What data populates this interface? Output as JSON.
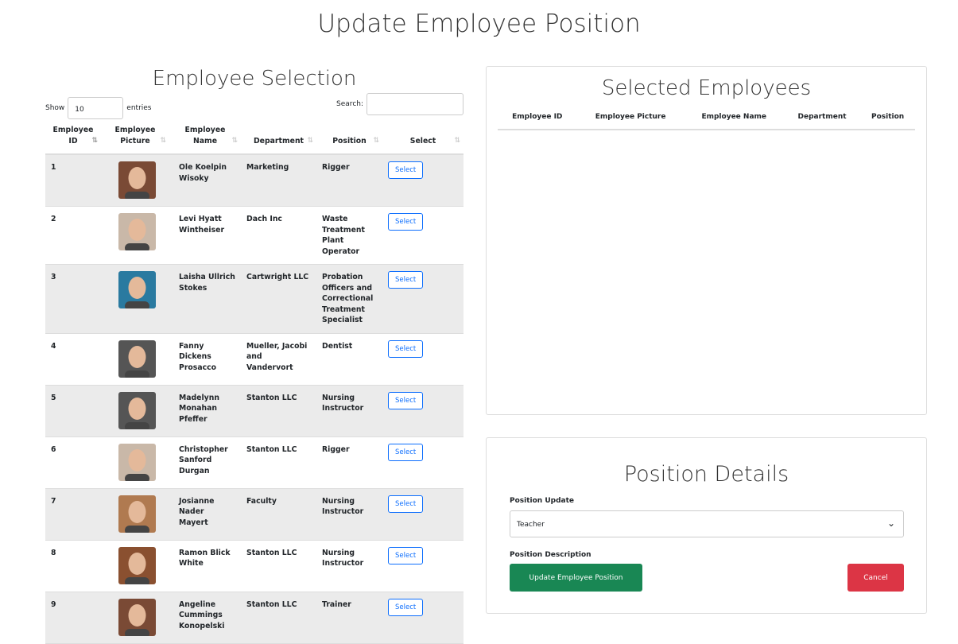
{
  "page_title": "Update Employee Position",
  "selection": {
    "title": "Employee Selection",
    "show_label": "Show",
    "entries_value": "10",
    "entries_label": "entries",
    "search_label": "Search:",
    "columns": [
      "Employee ID",
      "Employee Picture",
      "Employee Name",
      "Department",
      "Position",
      "Select"
    ],
    "rows": [
      {
        "id": "1",
        "name": "Ole Koelpin Wisoky",
        "department": "Marketing",
        "position": "Rigger",
        "select": "Select",
        "photo_color": "#7a4a35"
      },
      {
        "id": "2",
        "name": "Levi Hyatt Wintheiser",
        "department": "Dach Inc",
        "position": "Waste Treatment Plant Operator",
        "select": "Select",
        "photo_color": "#c9b8a8"
      },
      {
        "id": "3",
        "name": "Laisha Ullrich Stokes",
        "department": "Cartwright LLC",
        "position": "Probation Officers and Correctional Treatment Specialist",
        "select": "Select",
        "photo_color": "#2a7aa0"
      },
      {
        "id": "4",
        "name": "Fanny Dickens Prosacco",
        "department": "Mueller, Jacobi and Vandervort",
        "position": "Dentist",
        "select": "Select",
        "photo_color": "#555555"
      },
      {
        "id": "5",
        "name": "Madelynn Monahan Pfeffer",
        "department": "Stanton LLC",
        "position": "Nursing Instructor",
        "select": "Select",
        "photo_color": "#555555"
      },
      {
        "id": "6",
        "name": "Christopher Sanford Durgan",
        "department": "Stanton LLC",
        "position": "Rigger",
        "select": "Select",
        "photo_color": "#c9b8a8"
      },
      {
        "id": "7",
        "name": "Josianne Nader Mayert",
        "department": "Faculty",
        "position": "Nursing Instructor",
        "select": "Select",
        "photo_color": "#b07a50"
      },
      {
        "id": "8",
        "name": "Ramon Blick White",
        "department": "Stanton LLC",
        "position": "Nursing Instructor",
        "select": "Select",
        "photo_color": "#8a5030"
      },
      {
        "id": "9",
        "name": "Angeline Cummings Konopelski",
        "department": "Stanton LLC",
        "position": "Trainer",
        "select": "Select",
        "photo_color": "#7a4a35"
      }
    ]
  },
  "selected": {
    "title": "Selected Employees",
    "columns": [
      "Employee ID",
      "Employee Picture",
      "Employee Name",
      "Department",
      "Position"
    ]
  },
  "details": {
    "title": "Position Details",
    "position_update_label": "Position Update",
    "position_value": "Teacher",
    "description_label": "Position Description",
    "update_button": "Update Employee Position",
    "cancel_button": "Cancel",
    "update_color": "#198754",
    "cancel_color": "#dc3545"
  }
}
